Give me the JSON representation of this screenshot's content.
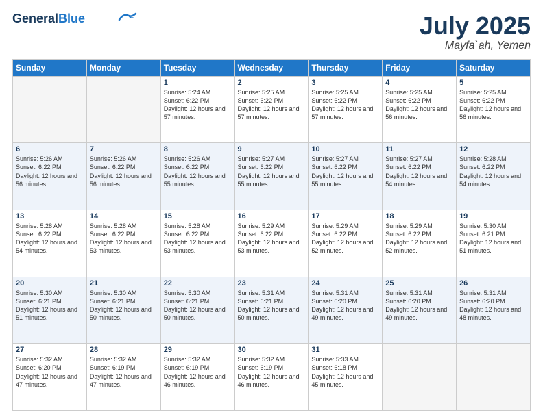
{
  "header": {
    "logo_line1": "General",
    "logo_line2": "Blue",
    "month": "July 2025",
    "location": "Mayfa`ah, Yemen"
  },
  "weekdays": [
    "Sunday",
    "Monday",
    "Tuesday",
    "Wednesday",
    "Thursday",
    "Friday",
    "Saturday"
  ],
  "weeks": [
    [
      {
        "day": "",
        "empty": true
      },
      {
        "day": "",
        "empty": true
      },
      {
        "day": "1",
        "sunrise": "Sunrise: 5:24 AM",
        "sunset": "Sunset: 6:22 PM",
        "daylight": "Daylight: 12 hours and 57 minutes."
      },
      {
        "day": "2",
        "sunrise": "Sunrise: 5:25 AM",
        "sunset": "Sunset: 6:22 PM",
        "daylight": "Daylight: 12 hours and 57 minutes."
      },
      {
        "day": "3",
        "sunrise": "Sunrise: 5:25 AM",
        "sunset": "Sunset: 6:22 PM",
        "daylight": "Daylight: 12 hours and 57 minutes."
      },
      {
        "day": "4",
        "sunrise": "Sunrise: 5:25 AM",
        "sunset": "Sunset: 6:22 PM",
        "daylight": "Daylight: 12 hours and 56 minutes."
      },
      {
        "day": "5",
        "sunrise": "Sunrise: 5:25 AM",
        "sunset": "Sunset: 6:22 PM",
        "daylight": "Daylight: 12 hours and 56 minutes."
      }
    ],
    [
      {
        "day": "6",
        "sunrise": "Sunrise: 5:26 AM",
        "sunset": "Sunset: 6:22 PM",
        "daylight": "Daylight: 12 hours and 56 minutes."
      },
      {
        "day": "7",
        "sunrise": "Sunrise: 5:26 AM",
        "sunset": "Sunset: 6:22 PM",
        "daylight": "Daylight: 12 hours and 56 minutes."
      },
      {
        "day": "8",
        "sunrise": "Sunrise: 5:26 AM",
        "sunset": "Sunset: 6:22 PM",
        "daylight": "Daylight: 12 hours and 55 minutes."
      },
      {
        "day": "9",
        "sunrise": "Sunrise: 5:27 AM",
        "sunset": "Sunset: 6:22 PM",
        "daylight": "Daylight: 12 hours and 55 minutes."
      },
      {
        "day": "10",
        "sunrise": "Sunrise: 5:27 AM",
        "sunset": "Sunset: 6:22 PM",
        "daylight": "Daylight: 12 hours and 55 minutes."
      },
      {
        "day": "11",
        "sunrise": "Sunrise: 5:27 AM",
        "sunset": "Sunset: 6:22 PM",
        "daylight": "Daylight: 12 hours and 54 minutes."
      },
      {
        "day": "12",
        "sunrise": "Sunrise: 5:28 AM",
        "sunset": "Sunset: 6:22 PM",
        "daylight": "Daylight: 12 hours and 54 minutes."
      }
    ],
    [
      {
        "day": "13",
        "sunrise": "Sunrise: 5:28 AM",
        "sunset": "Sunset: 6:22 PM",
        "daylight": "Daylight: 12 hours and 54 minutes."
      },
      {
        "day": "14",
        "sunrise": "Sunrise: 5:28 AM",
        "sunset": "Sunset: 6:22 PM",
        "daylight": "Daylight: 12 hours and 53 minutes."
      },
      {
        "day": "15",
        "sunrise": "Sunrise: 5:28 AM",
        "sunset": "Sunset: 6:22 PM",
        "daylight": "Daylight: 12 hours and 53 minutes."
      },
      {
        "day": "16",
        "sunrise": "Sunrise: 5:29 AM",
        "sunset": "Sunset: 6:22 PM",
        "daylight": "Daylight: 12 hours and 53 minutes."
      },
      {
        "day": "17",
        "sunrise": "Sunrise: 5:29 AM",
        "sunset": "Sunset: 6:22 PM",
        "daylight": "Daylight: 12 hours and 52 minutes."
      },
      {
        "day": "18",
        "sunrise": "Sunrise: 5:29 AM",
        "sunset": "Sunset: 6:22 PM",
        "daylight": "Daylight: 12 hours and 52 minutes."
      },
      {
        "day": "19",
        "sunrise": "Sunrise: 5:30 AM",
        "sunset": "Sunset: 6:21 PM",
        "daylight": "Daylight: 12 hours and 51 minutes."
      }
    ],
    [
      {
        "day": "20",
        "sunrise": "Sunrise: 5:30 AM",
        "sunset": "Sunset: 6:21 PM",
        "daylight": "Daylight: 12 hours and 51 minutes."
      },
      {
        "day": "21",
        "sunrise": "Sunrise: 5:30 AM",
        "sunset": "Sunset: 6:21 PM",
        "daylight": "Daylight: 12 hours and 50 minutes."
      },
      {
        "day": "22",
        "sunrise": "Sunrise: 5:30 AM",
        "sunset": "Sunset: 6:21 PM",
        "daylight": "Daylight: 12 hours and 50 minutes."
      },
      {
        "day": "23",
        "sunrise": "Sunrise: 5:31 AM",
        "sunset": "Sunset: 6:21 PM",
        "daylight": "Daylight: 12 hours and 50 minutes."
      },
      {
        "day": "24",
        "sunrise": "Sunrise: 5:31 AM",
        "sunset": "Sunset: 6:20 PM",
        "daylight": "Daylight: 12 hours and 49 minutes."
      },
      {
        "day": "25",
        "sunrise": "Sunrise: 5:31 AM",
        "sunset": "Sunset: 6:20 PM",
        "daylight": "Daylight: 12 hours and 49 minutes."
      },
      {
        "day": "26",
        "sunrise": "Sunrise: 5:31 AM",
        "sunset": "Sunset: 6:20 PM",
        "daylight": "Daylight: 12 hours and 48 minutes."
      }
    ],
    [
      {
        "day": "27",
        "sunrise": "Sunrise: 5:32 AM",
        "sunset": "Sunset: 6:20 PM",
        "daylight": "Daylight: 12 hours and 47 minutes."
      },
      {
        "day": "28",
        "sunrise": "Sunrise: 5:32 AM",
        "sunset": "Sunset: 6:19 PM",
        "daylight": "Daylight: 12 hours and 47 minutes."
      },
      {
        "day": "29",
        "sunrise": "Sunrise: 5:32 AM",
        "sunset": "Sunset: 6:19 PM",
        "daylight": "Daylight: 12 hours and 46 minutes."
      },
      {
        "day": "30",
        "sunrise": "Sunrise: 5:32 AM",
        "sunset": "Sunset: 6:19 PM",
        "daylight": "Daylight: 12 hours and 46 minutes."
      },
      {
        "day": "31",
        "sunrise": "Sunrise: 5:33 AM",
        "sunset": "Sunset: 6:18 PM",
        "daylight": "Daylight: 12 hours and 45 minutes."
      },
      {
        "day": "",
        "empty": true
      },
      {
        "day": "",
        "empty": true
      }
    ]
  ]
}
